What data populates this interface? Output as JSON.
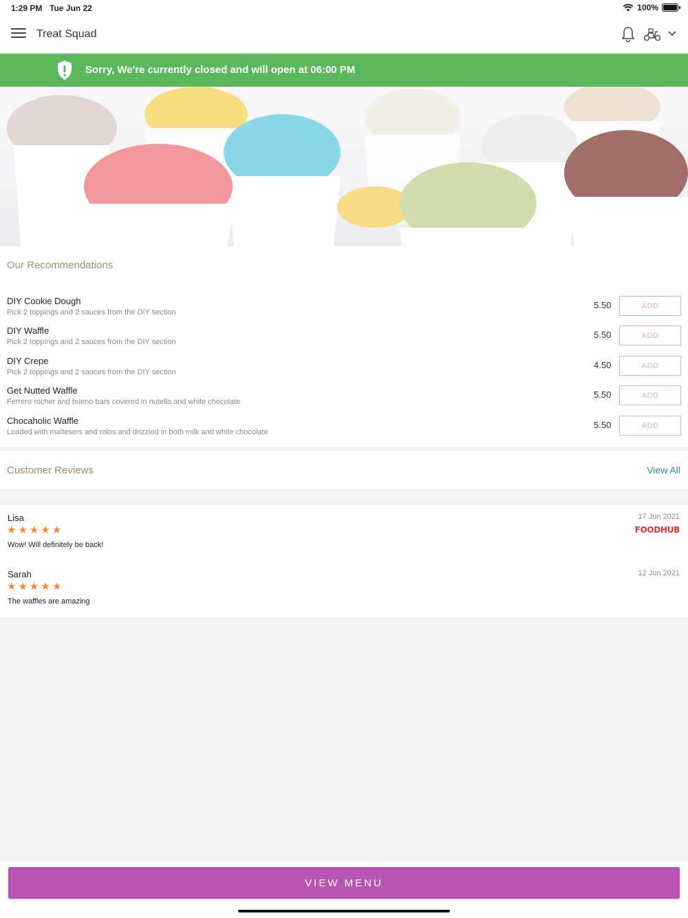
{
  "status_bar": {
    "time": "1:29 PM",
    "date": "Tue Jun 22",
    "battery": "100%"
  },
  "header": {
    "title": "Treat Squad"
  },
  "banner": {
    "message": "Sorry, We're currently closed and will open at 06:00 PM",
    "color": "#5cb85c"
  },
  "recommendations": {
    "title": "Our Recommendations",
    "add_label": "ADD",
    "items": [
      {
        "name": "DIY Cookie Dough",
        "description": "Pick 2 toppings and 2 sauces from the DIY section",
        "price": "5.50"
      },
      {
        "name": "DIY Waffle",
        "description": "Pick 2 toppings and 2 sauces from the DIY section",
        "price": "5.50"
      },
      {
        "name": "DIY Crepe",
        "description": "Pick 2 toppings and 2 sauces from the DIY section",
        "price": "4.50"
      },
      {
        "name": "Get Nutted Waffle",
        "description": "Ferrero rocher and bueno bars covered in nutella and white chocolate",
        "price": "5.50"
      },
      {
        "name": "Chocaholic Waffle",
        "description": "Loaded with maltesers and rolos and drizzled in both milk and white chocolate",
        "price": "5.50"
      }
    ]
  },
  "reviews": {
    "title": "Customer Reviews",
    "view_all": "View All",
    "items": [
      {
        "reviewer": "Lisa",
        "rating": 5,
        "text": "Wow! Will definitely be back!",
        "date": "17 Jun 2021",
        "source": "FOODHUB"
      },
      {
        "reviewer": "Sarah",
        "rating": 5,
        "text": "The waffles are amazing",
        "date": "12 Jun 2021",
        "source": ""
      }
    ]
  },
  "footer": {
    "view_menu": "VIEW MENU",
    "accent": "#b855b0"
  }
}
